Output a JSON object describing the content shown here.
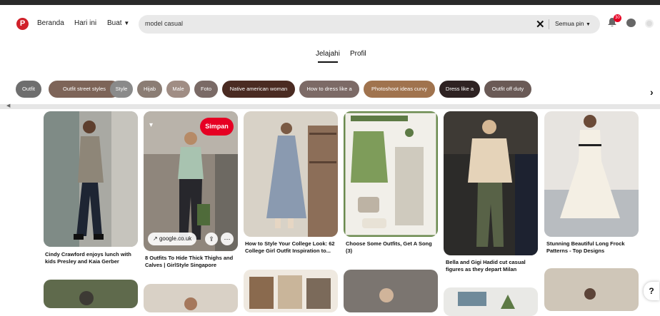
{
  "nav": {
    "home": "Beranda",
    "today": "Hari ini",
    "create": "Buat"
  },
  "search": {
    "query": "model casual",
    "filter": "Semua pin"
  },
  "notifications": {
    "count": "30"
  },
  "tabs": {
    "explore": "Jelajahi",
    "profile": "Profil"
  },
  "chips": [
    {
      "label": "Outfit",
      "color": "#6e6e6e"
    },
    {
      "label": "Outfit street styles",
      "color": "#7d6458"
    },
    {
      "label": "Style",
      "color": "#8a8a8a"
    },
    {
      "label": "Hijab",
      "color": "#8b7d74"
    },
    {
      "label": "Male",
      "color": "#a08d84"
    },
    {
      "label": "Foto",
      "color": "#7a6a66"
    },
    {
      "label": "Native american woman",
      "color": "#4a2b22"
    },
    {
      "label": "How to dress like a",
      "color": "#7c6a66"
    },
    {
      "label": "Photoshoot ideas curvy",
      "color": "#a0734e"
    },
    {
      "label": "Dress like a",
      "color": "#2e2222"
    },
    {
      "label": "Outfit off duty",
      "color": "#6a5a56"
    }
  ],
  "pins": [
    {
      "caption": "Cindy Crawford enjoys lunch with kids Presley and Kaia Gerber"
    },
    {
      "caption": "8 Outfits To Hide Thick Thighs and Calves | GirlStyle Singapore",
      "save": "Simpan",
      "domain": "google.co.uk"
    },
    {
      "caption": "How to Style Your College Look: 62 College Girl Outfit Inspiration to..."
    },
    {
      "caption": "Choose Some Outfits, Get A Song (3)"
    },
    {
      "caption": "Bella and Gigi Hadid cut casual figures as they depart Milan"
    },
    {
      "caption": "Stunning Beautiful Long Frock Patterns - Top Designs"
    }
  ],
  "help": "?"
}
